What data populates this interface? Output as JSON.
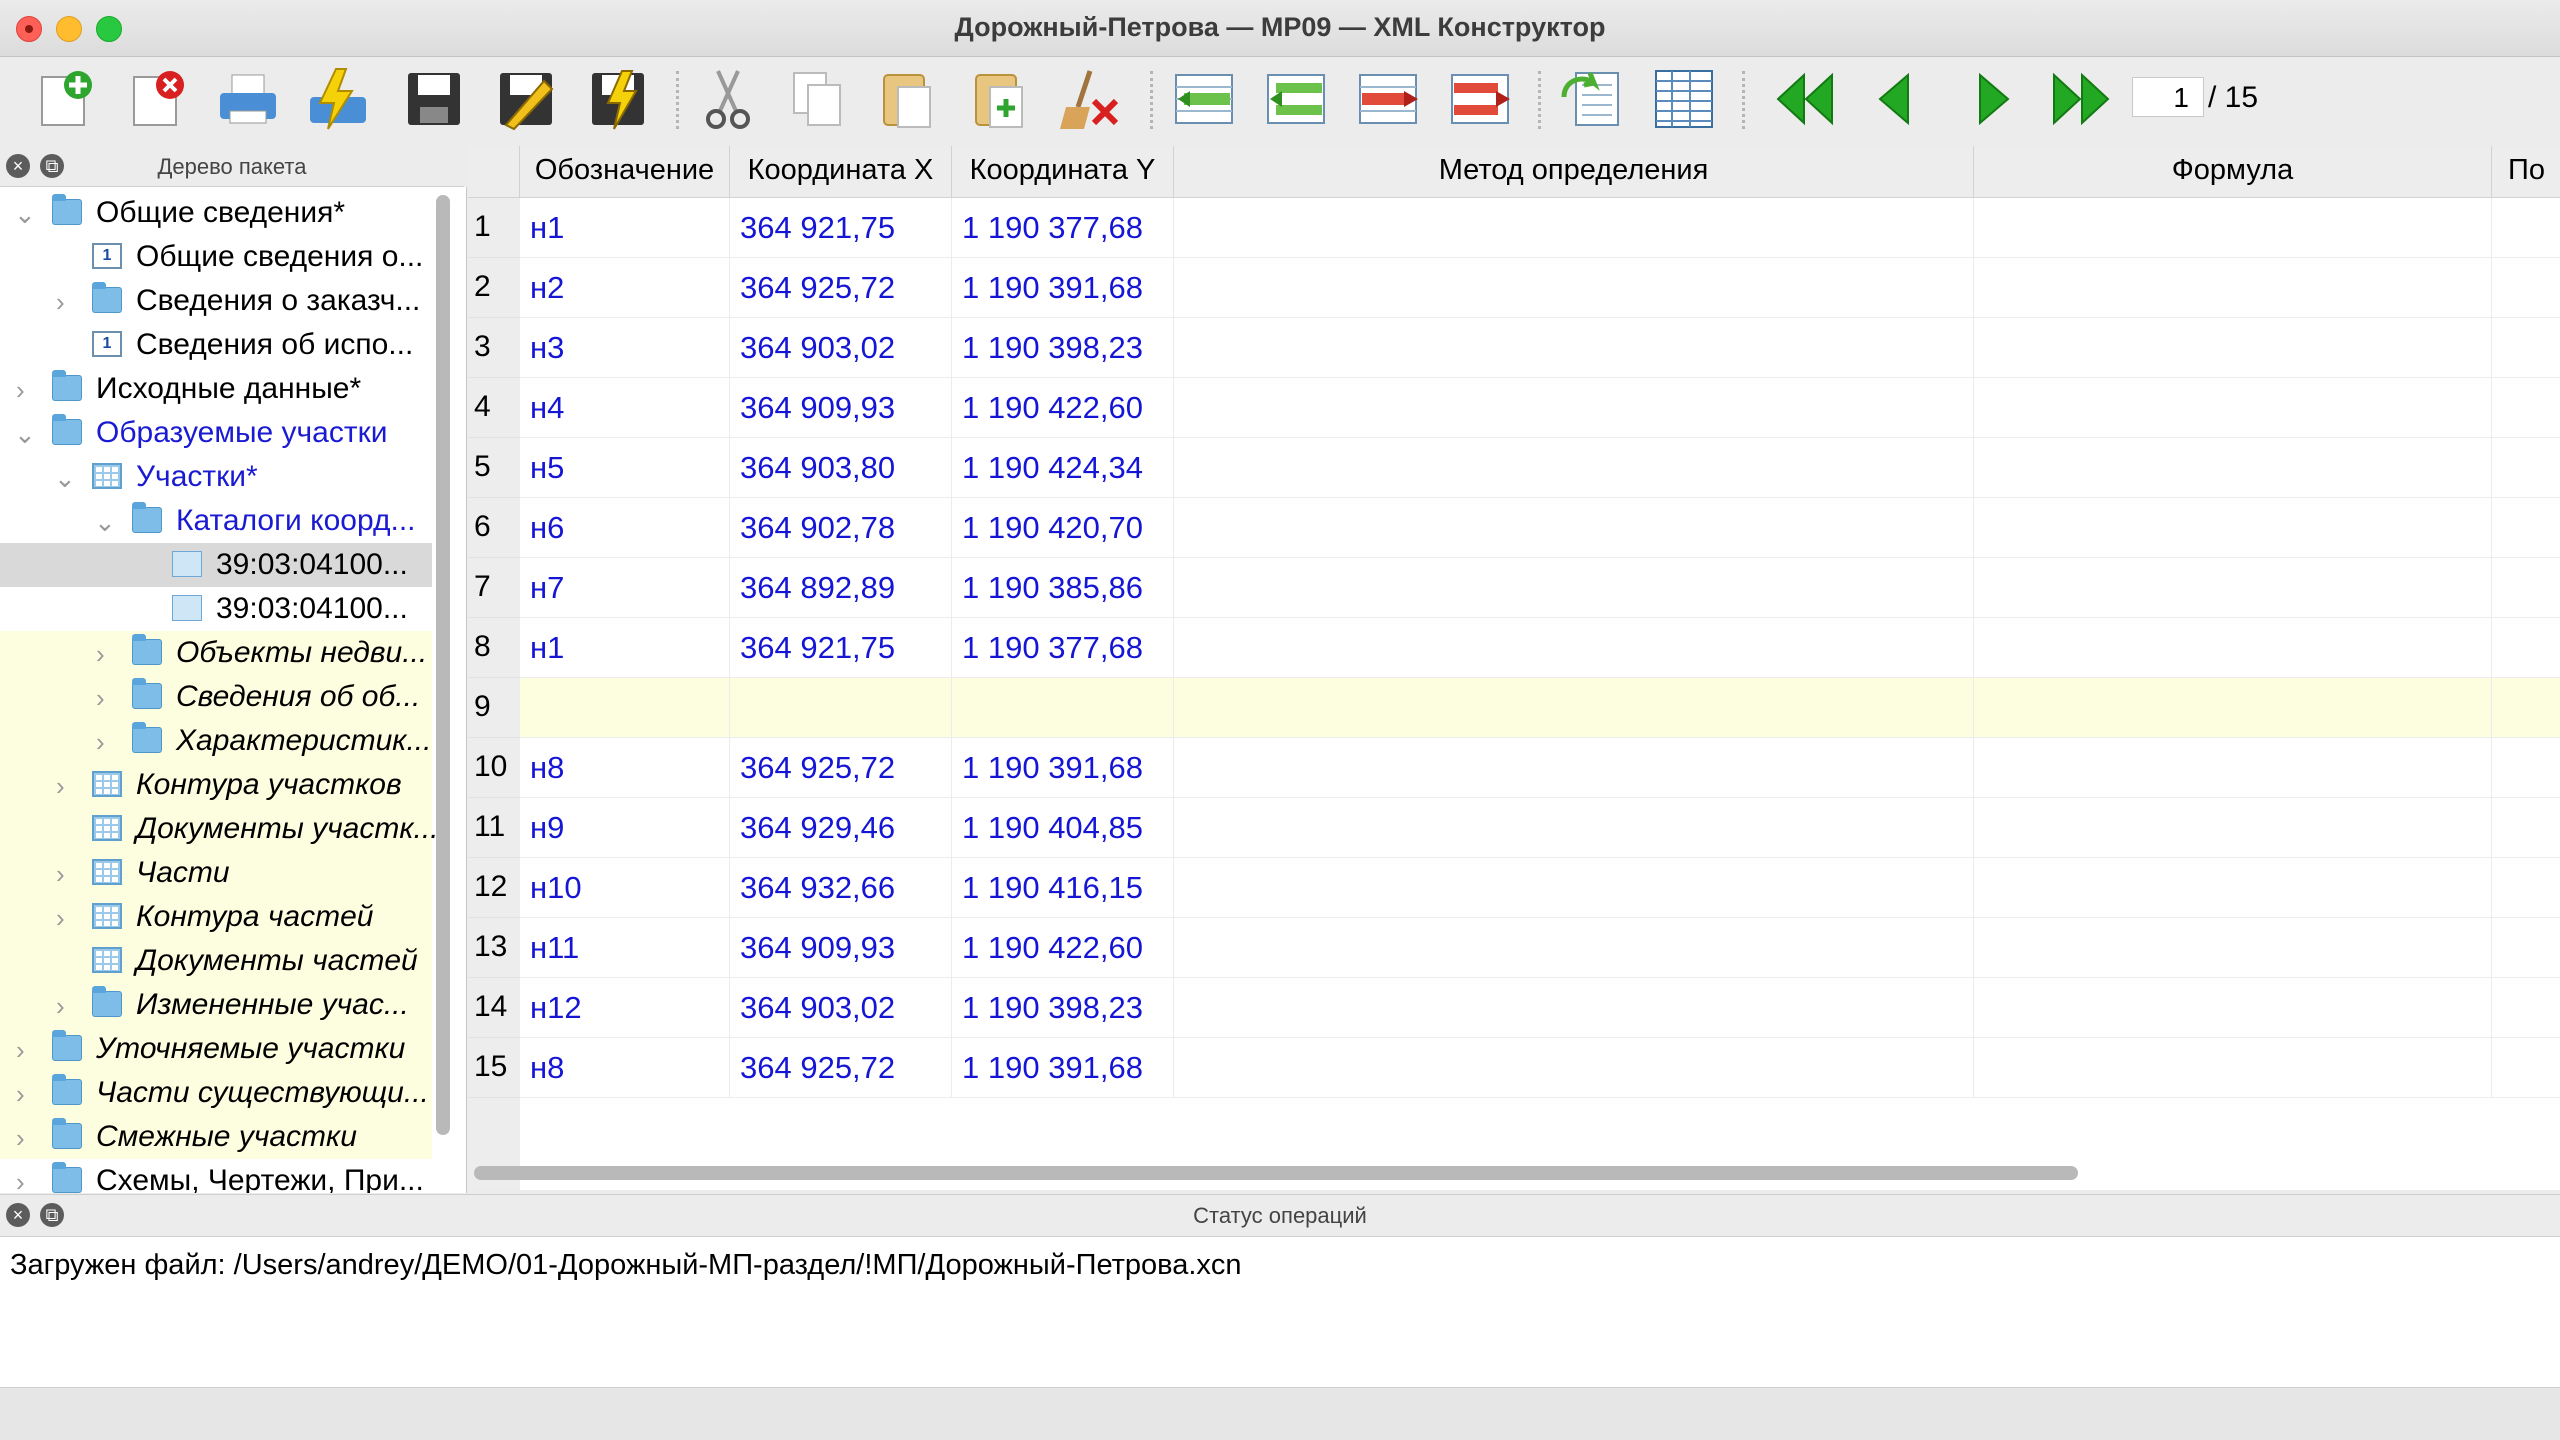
{
  "window": {
    "title": "Дорожный-Петрова — МР09 — XML Конструктор"
  },
  "toolbar": {
    "buttons": [
      "new-document-icon",
      "delete-document-icon",
      "print-icon",
      "validate-icon",
      "save-icon",
      "edit-save-icon",
      "save-validate-icon",
      "cut-icon",
      "copy-icon",
      "paste-icon",
      "paste-new-icon",
      "clear-icon",
      "insert-row-before-icon",
      "insert-rows-icon",
      "append-row-icon",
      "append-rows-icon",
      "import-icon",
      "table-view-icon",
      "first-page-icon",
      "previous-page-icon",
      "next-page-icon",
      "last-page-icon"
    ],
    "page": {
      "current": "1",
      "total": "/ 15"
    }
  },
  "tree": {
    "title": "Дерево пакета",
    "items": [
      {
        "label": "Общие сведения*",
        "style": "normal",
        "expanded": true
      },
      {
        "label": "Общие сведения о...",
        "style": "normal"
      },
      {
        "label": "Сведения о заказч...",
        "style": "normal"
      },
      {
        "label": "Сведения об испо...",
        "style": "normal"
      },
      {
        "label": "Исходные данные*",
        "style": "normal"
      },
      {
        "label": "Образуемые участки",
        "style": "blue",
        "expanded": true
      },
      {
        "label": "Участки*",
        "style": "blue",
        "expanded": true
      },
      {
        "label": "Каталоги коорд...",
        "style": "blue",
        "expanded": true
      },
      {
        "label": "39:03:04100...",
        "style": "normal",
        "selected": true
      },
      {
        "label": "39:03:04100...",
        "style": "normal"
      },
      {
        "label": "Объекты недви...",
        "style": "italic"
      },
      {
        "label": "Сведения об об...",
        "style": "italic"
      },
      {
        "label": "Характеристик...",
        "style": "italic"
      },
      {
        "label": "Контура участков",
        "style": "italic"
      },
      {
        "label": "Документы участк...",
        "style": "italic"
      },
      {
        "label": "Части",
        "style": "italic"
      },
      {
        "label": "Контура частей",
        "style": "italic"
      },
      {
        "label": "Документы частей",
        "style": "italic"
      },
      {
        "label": "Измененные учас...",
        "style": "italic"
      },
      {
        "label": "Уточняемые участки",
        "style": "italic"
      },
      {
        "label": "Части существующи...",
        "style": "italic"
      },
      {
        "label": "Смежные участки",
        "style": "italic"
      },
      {
        "label": "Схемы, Чертежи, При...",
        "style": "normal"
      }
    ]
  },
  "table": {
    "columns": [
      "Обозначение",
      "Координата X",
      "Координата Y",
      "Метод определения",
      "Формула",
      "По"
    ],
    "rows": [
      [
        "1",
        "н1",
        "364 921,75",
        "1 190 377,68"
      ],
      [
        "2",
        "н2",
        "364 925,72",
        "1 190 391,68"
      ],
      [
        "3",
        "н3",
        "364 903,02",
        "1 190 398,23"
      ],
      [
        "4",
        "н4",
        "364 909,93",
        "1 190 422,60"
      ],
      [
        "5",
        "н5",
        "364 903,80",
        "1 190 424,34"
      ],
      [
        "6",
        "н6",
        "364 902,78",
        "1 190 420,70"
      ],
      [
        "7",
        "н7",
        "364 892,89",
        "1 190 385,86"
      ],
      [
        "8",
        "н1",
        "364 921,75",
        "1 190 377,68"
      ],
      [
        "9",
        "",
        "",
        ""
      ],
      [
        "10",
        "н8",
        "364 925,72",
        "1 190 391,68"
      ],
      [
        "11",
        "н9",
        "364 929,46",
        "1 190 404,85"
      ],
      [
        "12",
        "н10",
        "364 932,66",
        "1 190 416,15"
      ],
      [
        "13",
        "н11",
        "364 909,93",
        "1 190 422,60"
      ],
      [
        "14",
        "н12",
        "364 903,02",
        "1 190 398,23"
      ],
      [
        "15",
        "н8",
        "364 925,72",
        "1 190 391,68"
      ]
    ]
  },
  "status": {
    "title": "Статус операций",
    "message": "Загружен файл: /Users/andrey/ДЕМО/01-Дорожный-МП-раздел/!МП/Дорожный-Петрова.xcn"
  },
  "colors": {
    "value_text": "#1515d5",
    "highlight_row": "#fdfde0",
    "selected_row": "#d9d9d9"
  }
}
